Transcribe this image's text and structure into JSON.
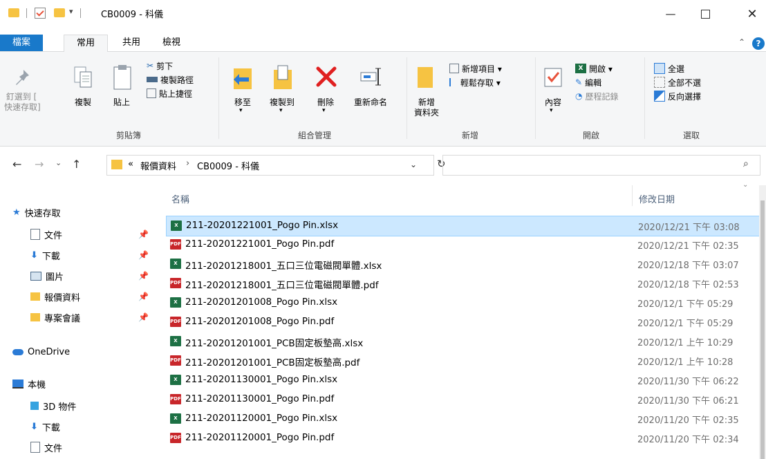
{
  "window": {
    "title": "CB0009 - 科儀"
  },
  "tabs": [
    "檔案",
    "常用",
    "共用",
    "檢視"
  ],
  "ribbon": {
    "clipboard": {
      "pin_label_1": "釘選到 [",
      "pin_label_2": "快速存取]",
      "copy": "複製",
      "paste": "貼上",
      "cut": "剪下",
      "copy_path": "複製路徑",
      "paste_shortcut": "貼上捷徑",
      "group": "剪貼簿"
    },
    "organize": {
      "move_to": "移至",
      "copy_to": "複製到",
      "delete": "刪除",
      "rename": "重新命名",
      "group": "組合管理"
    },
    "new": {
      "new_folder_1": "新增",
      "new_folder_2": "資料夾",
      "new_item": "新增項目 ▾",
      "easy_access": "輕鬆存取 ▾",
      "group": "新增"
    },
    "open": {
      "properties": "內容",
      "open": "開啟 ▾",
      "edit": "編輯",
      "history": "歷程記錄",
      "group": "開啟"
    },
    "select": {
      "select_all": "全選",
      "select_none": "全部不選",
      "invert": "反向選擇",
      "group": "選取"
    }
  },
  "address": {
    "prefix": "«",
    "crumb1": "報價資料",
    "crumb2": "CB0009 - 科儀"
  },
  "nav": {
    "quick_access": "快速存取",
    "items": [
      {
        "label": "文件",
        "pinned": true
      },
      {
        "label": "下載",
        "pinned": true
      },
      {
        "label": "圖片",
        "pinned": true
      },
      {
        "label": "報價資料",
        "pinned": true
      },
      {
        "label": "專案會議",
        "pinned": true
      }
    ],
    "onedrive": "OneDrive",
    "this_pc": "本機",
    "pc_items": [
      "3D 物件",
      "下載",
      "文件"
    ]
  },
  "columns": {
    "name": "名稱",
    "date": "修改日期"
  },
  "files": [
    {
      "name": "211-20201221001_Pogo Pin.xlsx",
      "date": "2020/12/21 下午 03:08",
      "type": "xlsx",
      "selected": true
    },
    {
      "name": "211-20201221001_Pogo Pin.pdf",
      "date": "2020/12/21 下午 02:35",
      "type": "pdf"
    },
    {
      "name": "211-20201218001_五口三位電磁閥單體.xlsx",
      "date": "2020/12/18 下午 03:07",
      "type": "xlsx"
    },
    {
      "name": "211-20201218001_五口三位電磁閥單體.pdf",
      "date": "2020/12/18 下午 02:53",
      "type": "pdf"
    },
    {
      "name": "211-20201201008_Pogo Pin.xlsx",
      "date": "2020/12/1 下午 05:29",
      "type": "xlsx"
    },
    {
      "name": "211-20201201008_Pogo Pin.pdf",
      "date": "2020/12/1 下午 05:29",
      "type": "pdf"
    },
    {
      "name": "211-20201201001_PCB固定板墊高.xlsx",
      "date": "2020/12/1 上午 10:29",
      "type": "xlsx"
    },
    {
      "name": "211-20201201001_PCB固定板墊高.pdf",
      "date": "2020/12/1 上午 10:28",
      "type": "pdf"
    },
    {
      "name": "211-20201130001_Pogo Pin.xlsx",
      "date": "2020/11/30 下午 06:22",
      "type": "xlsx"
    },
    {
      "name": "211-20201130001_Pogo Pin.pdf",
      "date": "2020/11/30 下午 06:21",
      "type": "pdf"
    },
    {
      "name": "211-20201120001_Pogo Pin.xlsx",
      "date": "2020/11/20 下午 02:35",
      "type": "xlsx"
    },
    {
      "name": "211-20201120001_Pogo Pin.pdf",
      "date": "2020/11/20 下午 02:34",
      "type": "pdf"
    }
  ]
}
